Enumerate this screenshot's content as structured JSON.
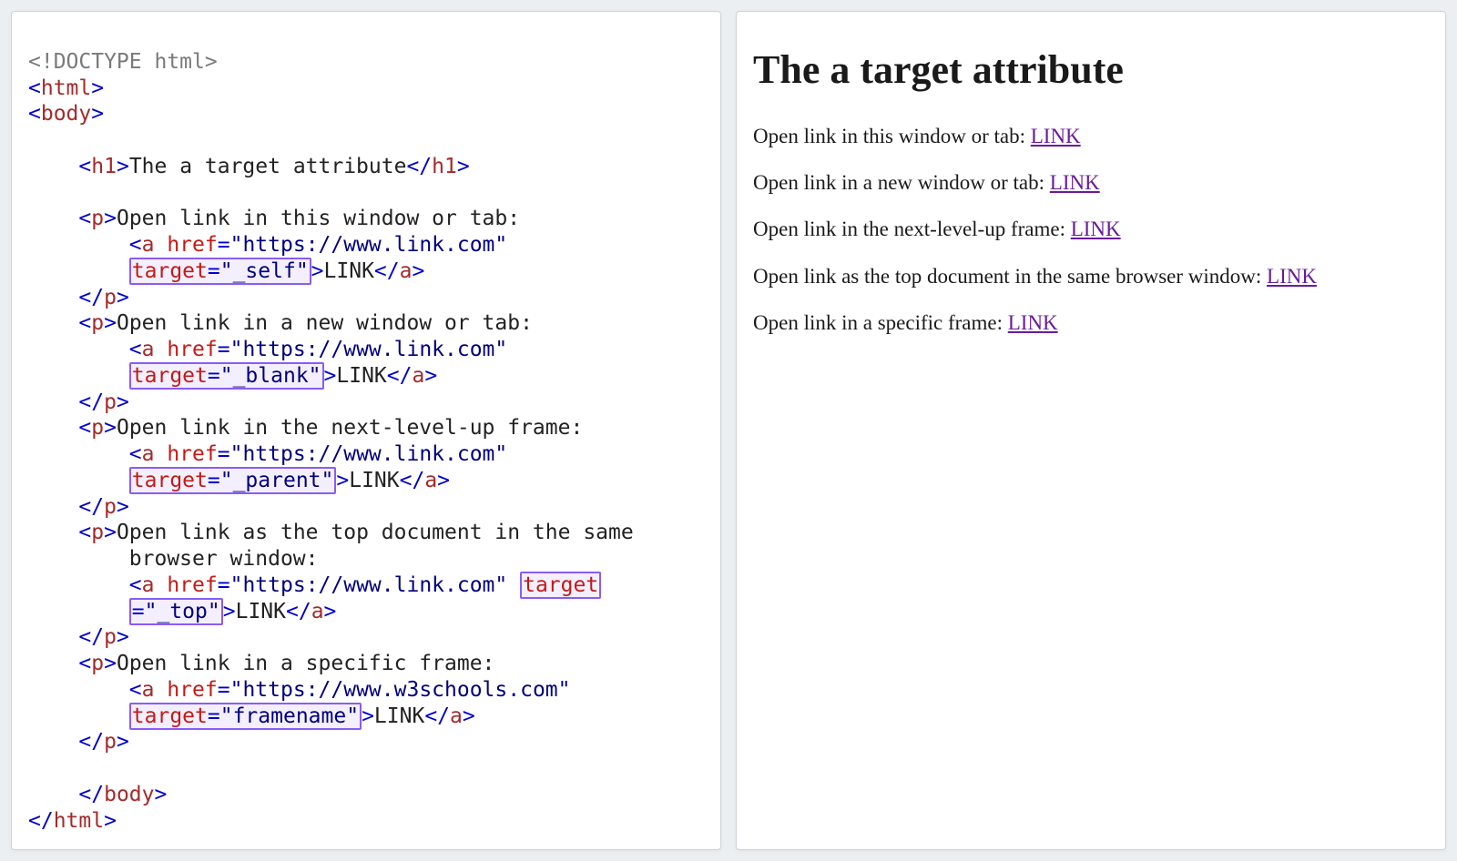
{
  "code": {
    "doctype": "<!DOCTYPE html>",
    "html_open": "<html>",
    "body_open": "<body>",
    "h1_open": "<h1>",
    "h1_text": "The a target attribute",
    "h1_close": "</h1>",
    "p_open": "<p>",
    "p_close": "</p>",
    "a_open": "<a",
    "a_close_angle": ">",
    "a_end_tag": "</a>",
    "link_text": "LINK",
    "href_attr": "href",
    "target_attr": "target",
    "eq": "=",
    "href_val_link": "\"https://www.link.com\"",
    "href_val_w3": "\"https://www.w3schools.com\"",
    "t_self": "\"_self\"",
    "t_blank": "\"_blank\"",
    "t_parent": "\"_parent\"",
    "t_top": "\"_top\"",
    "t_framename": "\"framename\"",
    "desc1": "Open link in this window or tab:",
    "desc2": "Open link in a new window or tab:",
    "desc3": "Open link in the next-level-up frame:",
    "desc4a": "Open link as the top document in the same",
    "desc4b": "browser window:",
    "desc5": "Open link in a specific frame:",
    "body_close": "</body>",
    "html_close": "</html>"
  },
  "render": {
    "heading": "The a target attribute",
    "items": [
      {
        "text": "Open link in this window or tab: ",
        "link": "LINK"
      },
      {
        "text": "Open link in a new window or tab: ",
        "link": "LINK"
      },
      {
        "text": "Open link in the next-level-up frame: ",
        "link": "LINK"
      },
      {
        "text": "Open link as the top document in the same browser window: ",
        "link": "LINK"
      },
      {
        "text": "Open link in a specific frame: ",
        "link": "LINK"
      }
    ]
  }
}
